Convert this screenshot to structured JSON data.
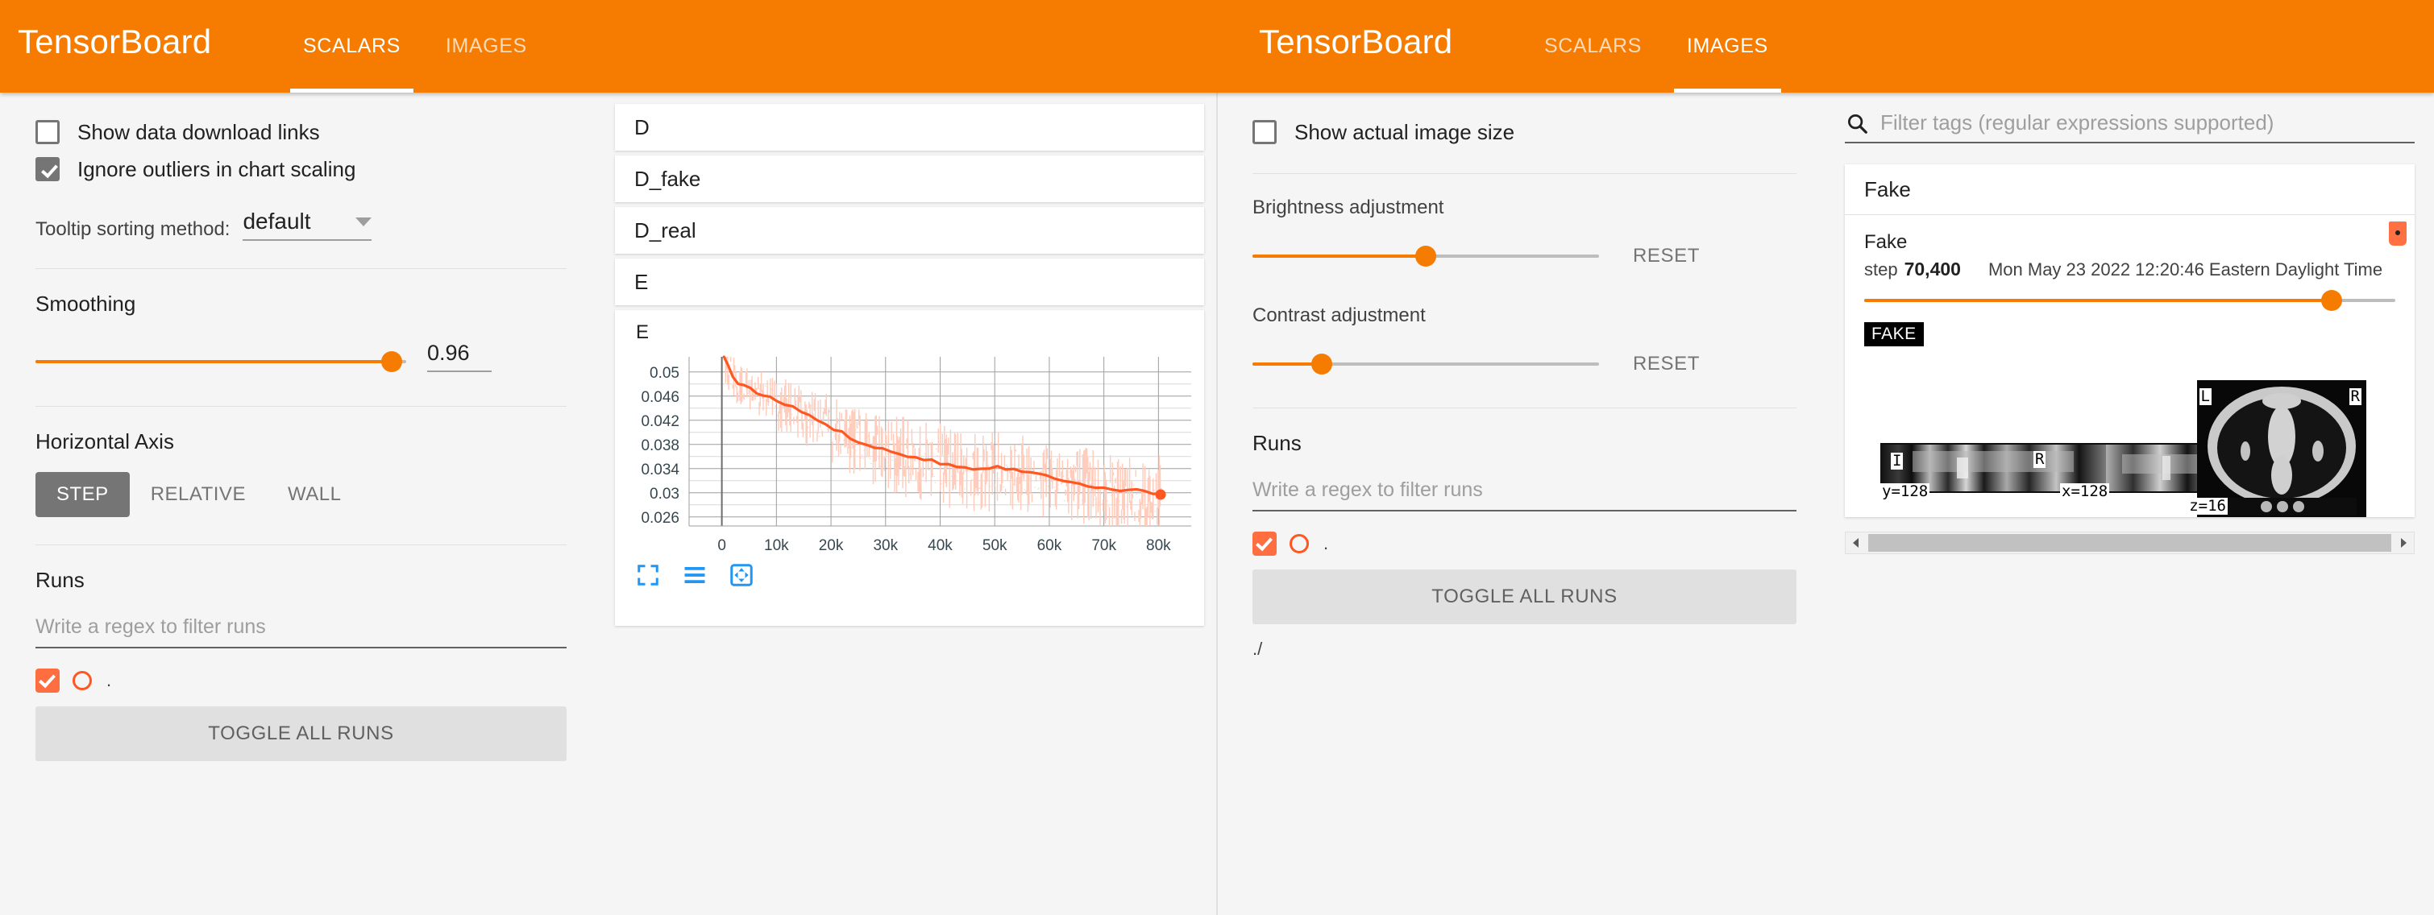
{
  "header": {
    "brand": "TensorBoard",
    "left_tabs": [
      {
        "label": "SCALARS",
        "active": true
      },
      {
        "label": "IMAGES",
        "active": false
      }
    ],
    "right_tabs": [
      {
        "label": "SCALARS",
        "active": false
      },
      {
        "label": "IMAGES",
        "active": true
      }
    ],
    "accent_color": "#F57C00"
  },
  "scalars": {
    "show_download_links": {
      "label": "Show data download links",
      "checked": false
    },
    "ignore_outliers": {
      "label": "Ignore outliers in chart scaling",
      "checked": true
    },
    "tooltip_sort": {
      "label": "Tooltip sorting method:",
      "value": "default"
    },
    "smoothing": {
      "label": "Smoothing",
      "value": "0.96",
      "percent": 96
    },
    "horizontal_axis": {
      "label": "Horizontal Axis",
      "options": [
        "STEP",
        "RELATIVE",
        "WALL"
      ],
      "selected": "STEP"
    },
    "runs": {
      "label": "Runs",
      "filter_placeholder": "Write a regex to filter runs",
      "items": [
        {
          "name": ".",
          "checked": true,
          "color": "#FF5722"
        }
      ],
      "toggle_all_label": "TOGGLE ALL RUNS"
    },
    "cards": [
      {
        "title": "D"
      },
      {
        "title": "D_fake"
      },
      {
        "title": "D_real"
      },
      {
        "title": "E"
      }
    ],
    "chart_card_title": "E",
    "toolbar_icons": [
      "expand-chart-icon",
      "data-table-icon",
      "pan-chart-icon"
    ]
  },
  "chart_data": {
    "type": "line",
    "title": "E",
    "xlabel": "",
    "ylabel": "",
    "xlim": [
      -6000,
      86000
    ],
    "ylim": [
      0.0245,
      0.0525
    ],
    "xticks": [
      "0",
      "10k",
      "20k",
      "30k",
      "40k",
      "50k",
      "60k",
      "70k",
      "80k"
    ],
    "xtick_values": [
      0,
      10000,
      20000,
      30000,
      40000,
      50000,
      60000,
      70000,
      80000
    ],
    "yticks": [
      "0.05",
      "0.046",
      "0.042",
      "0.038",
      "0.034",
      "0.03",
      "0.026"
    ],
    "ytick_values": [
      0.05,
      0.046,
      0.042,
      0.038,
      0.034,
      0.03,
      0.026
    ],
    "grid": true,
    "legend": "none",
    "series": [
      {
        "name": "smoothed",
        "color": "#FF5722",
        "x": [
          400,
          1200,
          2000,
          3000,
          4000,
          5200,
          6400,
          7600,
          8800,
          10000,
          11500,
          13000,
          14500,
          16000,
          17500,
          19000,
          20500,
          22000,
          23500,
          25000,
          26500,
          28000,
          29500,
          31000,
          32500,
          34000,
          35500,
          37000,
          38500,
          40000,
          41500,
          43000,
          44500,
          46000,
          47500,
          49000,
          50500,
          52000,
          53500,
          55000,
          56500,
          58000,
          59500,
          61000,
          62500,
          64000,
          65500,
          67000,
          68500,
          70000,
          71500,
          73000,
          74500,
          76000,
          77500,
          79000,
          80400
        ],
        "values": [
          0.0525,
          0.051,
          0.0492,
          0.048,
          0.0476,
          0.0472,
          0.0466,
          0.0461,
          0.0457,
          0.0452,
          0.0447,
          0.0441,
          0.0435,
          0.0428,
          0.0421,
          0.0414,
          0.0406,
          0.0399,
          0.0392,
          0.0386,
          0.0381,
          0.0377,
          0.0372,
          0.0368,
          0.0365,
          0.0362,
          0.0359,
          0.0356,
          0.0353,
          0.035,
          0.0347,
          0.0344,
          0.0342,
          0.0341,
          0.034,
          0.0342,
          0.0343,
          0.0341,
          0.0338,
          0.0336,
          0.0333,
          0.0331,
          0.0328,
          0.0325,
          0.0322,
          0.0319,
          0.0316,
          0.0313,
          0.031,
          0.0308,
          0.0306,
          0.0305,
          0.0304,
          0.0303,
          0.0301,
          0.03,
          0.0297
        ]
      },
      {
        "name": "raw",
        "color": "#FFCCBC",
        "note": "unsmoothed noisy series shown as light band"
      }
    ],
    "last_point": {
      "x": 80400,
      "y": 0.0297
    }
  },
  "images": {
    "show_actual_size": {
      "label": "Show actual image size",
      "checked": false
    },
    "brightness": {
      "label": "Brightness adjustment",
      "reset_label": "RESET",
      "percent": 50
    },
    "contrast": {
      "label": "Contrast adjustment",
      "reset_label": "RESET",
      "percent": 20
    },
    "runs": {
      "label": "Runs",
      "filter_placeholder": "Write a regex to filter runs",
      "items": [
        {
          "name": ".",
          "checked": true,
          "color": "#FF5722"
        }
      ],
      "toggle_all_label": "TOGGLE ALL RUNS",
      "extra": "./"
    },
    "filter_tags": {
      "placeholder": "Filter tags (regular expressions supported)",
      "icon": "search-icon"
    },
    "card": {
      "header": "Fake",
      "run_name": "Fake",
      "step_word": "step",
      "step_value": "70,400",
      "wall_time": "Mon May 23 2022 12:20:46 Eastern Daylight Time",
      "step_slider_percent": 88,
      "badge": "FAKE",
      "chip_color": "#FF7043",
      "scan_labels": {
        "sagittal": "y=128",
        "coronal": "x=128",
        "axial": "z=16",
        "left": "L",
        "right": "R",
        "inferior": "I",
        "right2": "R"
      }
    },
    "scrollbar": {
      "left_arrow": "◀",
      "right_arrow": "▶"
    }
  }
}
